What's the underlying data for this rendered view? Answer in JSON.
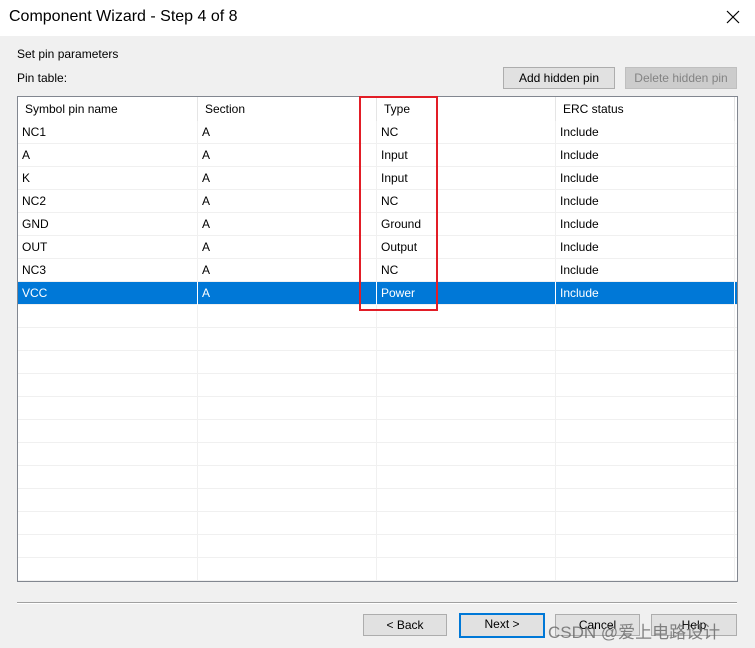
{
  "window": {
    "title": "Component Wizard - Step 4 of 8",
    "close_icon": "close-icon"
  },
  "section": {
    "heading": "Set pin parameters",
    "pin_table_label": "Pin table:"
  },
  "buttons": {
    "add_hidden_pin": "Add hidden pin",
    "delete_hidden_pin": "Delete hidden pin",
    "back": "< Back",
    "next": "Next >",
    "cancel": "Cancel",
    "help": "Help"
  },
  "table": {
    "columns": [
      "Symbol pin name",
      "Section",
      "Type",
      "ERC status"
    ],
    "rows": [
      [
        "NC1",
        "A",
        "NC",
        "Include"
      ],
      [
        "A",
        "A",
        "Input",
        "Include"
      ],
      [
        "K",
        "A",
        "Input",
        "Include"
      ],
      [
        "NC2",
        "A",
        "NC",
        "Include"
      ],
      [
        "GND",
        "A",
        "Ground",
        "Include"
      ],
      [
        "OUT",
        "A",
        "Output",
        "Include"
      ],
      [
        "NC3",
        "A",
        "NC",
        "Include"
      ],
      [
        "VCC",
        "A",
        "Power",
        "Include"
      ]
    ],
    "selected_row": 7,
    "empty_rows": 12
  },
  "colors": {
    "selection": "#0078d7",
    "highlight_box": "#e21d26"
  },
  "watermark": "CSDN @爱上电路设计"
}
